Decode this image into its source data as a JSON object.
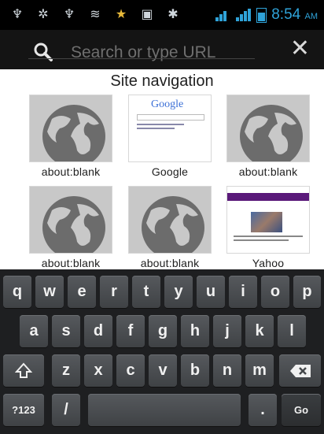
{
  "status_bar": {
    "time": "8:54",
    "ampm": "AM",
    "notification_icons": [
      "usb-icon",
      "android-debug-icon",
      "usb-icon",
      "wifi-icon",
      "star-icon",
      "image-icon",
      "alert-icon"
    ],
    "accent_color": "#2fa3d9"
  },
  "url_bar": {
    "placeholder": "Search or type URL",
    "search_icon": "search-icon",
    "close_icon": "close-icon"
  },
  "site_navigation": {
    "title": "Site navigation",
    "tiles": [
      {
        "label": "about:blank",
        "thumbnail": "globe"
      },
      {
        "label": "Google",
        "thumbnail": "google"
      },
      {
        "label": "about:blank",
        "thumbnail": "globe"
      },
      {
        "label": "about:blank",
        "thumbnail": "globe"
      },
      {
        "label": "about:blank",
        "thumbnail": "globe"
      },
      {
        "label": "Yahoo",
        "thumbnail": "yahoo"
      }
    ],
    "google_logo_text": "Google"
  },
  "keyboard": {
    "row1": [
      "q",
      "w",
      "e",
      "r",
      "t",
      "y",
      "u",
      "i",
      "o",
      "p"
    ],
    "row2": [
      "a",
      "s",
      "d",
      "f",
      "g",
      "h",
      "j",
      "k",
      "l"
    ],
    "row3": [
      "z",
      "x",
      "c",
      "v",
      "b",
      "n",
      "m"
    ],
    "symbols_key": "?123",
    "slash_key": "/",
    "period_key": ".",
    "go_key": "Go",
    "shift_icon": "shift-icon",
    "backspace_icon": "backspace-icon"
  }
}
